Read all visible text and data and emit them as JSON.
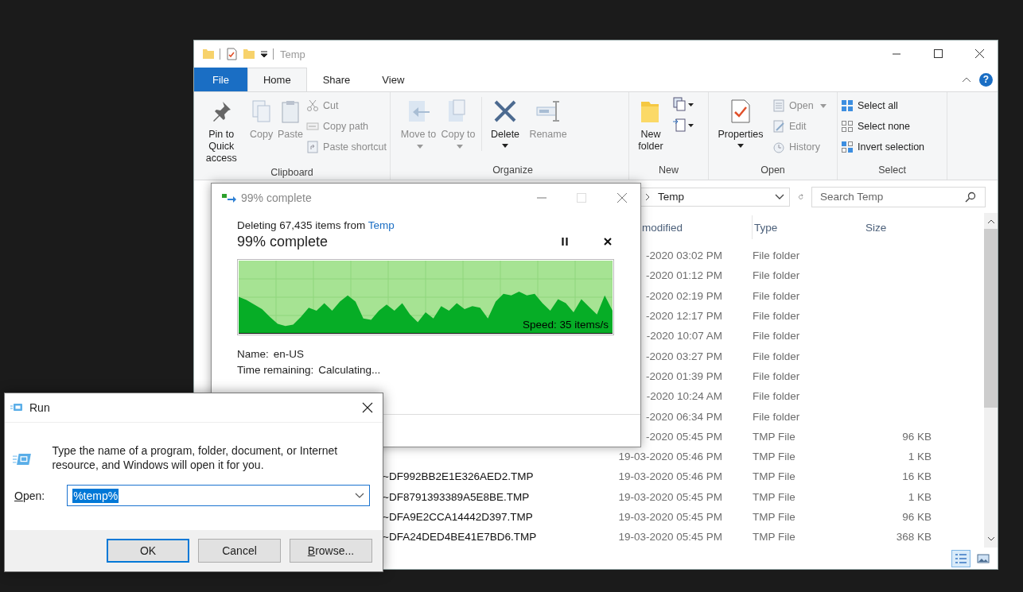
{
  "explorer": {
    "title": "Temp",
    "tabs": [
      {
        "label": "File",
        "kind": "backstage",
        "selected": false
      },
      {
        "label": "Home",
        "kind": "tab",
        "selected": true
      },
      {
        "label": "Share",
        "kind": "tab",
        "selected": false
      },
      {
        "label": "View",
        "kind": "tab",
        "selected": false
      }
    ],
    "help_label": "?",
    "ribbon": {
      "clipboard": {
        "label": "Clipboard",
        "pin": {
          "label": "Pin to Quick access",
          "disabled": false
        },
        "copy": {
          "label": "Copy",
          "disabled": true
        },
        "paste": {
          "label": "Paste",
          "disabled": true
        },
        "cut": {
          "label": "Cut",
          "disabled": true
        },
        "copy_path": {
          "label": "Copy path",
          "disabled": true
        },
        "paste_shortcut": {
          "label": "Paste shortcut",
          "disabled": true
        }
      },
      "organize": {
        "label": "Organize",
        "move_to": {
          "label": "Move to",
          "disabled": true
        },
        "copy_to": {
          "label": "Copy to",
          "disabled": true
        },
        "delete": {
          "label": "Delete",
          "disabled": false
        },
        "rename": {
          "label": "Rename",
          "disabled": true
        }
      },
      "new": {
        "label": "New",
        "new_folder": {
          "label": "New folder",
          "disabled": false
        }
      },
      "open": {
        "label": "Open",
        "properties": {
          "label": "Properties",
          "disabled": false
        },
        "open": {
          "label": "Open",
          "disabled": true
        },
        "edit": {
          "label": "Edit",
          "disabled": true
        },
        "history": {
          "label": "History",
          "disabled": true
        }
      },
      "select": {
        "label": "Select",
        "select_all": {
          "label": "Select all",
          "disabled": false
        },
        "select_none": {
          "label": "Select none",
          "disabled": false
        },
        "invert_selection": {
          "label": "Invert selection",
          "disabled": false
        }
      }
    },
    "address": {
      "location": "Temp"
    },
    "search": {
      "placeholder": "Search Temp"
    },
    "columns": {
      "date": "modified",
      "type": "Type",
      "size": "Size"
    },
    "rows": [
      {
        "date": "-2020 03:02 PM",
        "type": "File folder"
      },
      {
        "date": "-2020 01:12 PM",
        "type": "File folder"
      },
      {
        "date": "-2020 02:19 PM",
        "type": "File folder"
      },
      {
        "date": "-2020 12:17 PM",
        "type": "File folder"
      },
      {
        "date": "-2020 10:07 AM",
        "type": "File folder"
      },
      {
        "date": "-2020 03:27 PM",
        "type": "File folder"
      },
      {
        "date": "-2020 01:39 PM",
        "type": "File folder"
      },
      {
        "date": "-2020 10:24 AM",
        "type": "File folder"
      },
      {
        "date": "-2020 06:34 PM",
        "type": "File folder"
      },
      {
        "date": "-2020 05:45 PM",
        "type": "TMP File",
        "size": "96 KB"
      },
      {
        "date": "19-03-2020 05:46 PM",
        "type": "TMP File",
        "size": "1 KB"
      },
      {
        "name": "~DF992BB2E1E326AED2.TMP",
        "date": "19-03-2020 05:46 PM",
        "type": "TMP File",
        "size": "16 KB"
      },
      {
        "name": "~DF8791393389A5E8BE.TMP",
        "date": "19-03-2020 05:45 PM",
        "type": "TMP File",
        "size": "1 KB"
      },
      {
        "name": "~DFA9E2CCA14442D397.TMP",
        "date": "19-03-2020 05:45 PM",
        "type": "TMP File",
        "size": "96 KB"
      },
      {
        "name": "~DFA24DED4BE41E7BD6.TMP",
        "date": "19-03-2020 05:45 PM",
        "type": "TMP File",
        "size": "368 KB"
      }
    ],
    "view_buttons": [
      {
        "kind": "details",
        "selected": true
      },
      {
        "kind": "large_icons",
        "selected": false
      }
    ]
  },
  "progress_dialog": {
    "title": "99% complete",
    "can_maximize": false,
    "message": "Deleting 67,435 items from",
    "message_link": "Temp",
    "status": "99% complete",
    "speed": "Speed: 35 items/s",
    "details": [
      {
        "label": "Name:",
        "value": "en-US"
      },
      {
        "label": "Time remaining:",
        "value": "Calculating..."
      }
    ]
  },
  "run_dialog": {
    "title": "Run",
    "description": "Type the name of a program, folder, document, or Internet resource, and Windows will open it for you.",
    "open_label": "Open:",
    "open_label_mnemonic": true,
    "value": "%temp%",
    "value_selected": true,
    "buttons": [
      {
        "label": "OK",
        "default": true,
        "mnemonic": false
      },
      {
        "label": "Cancel",
        "default": false,
        "mnemonic": false
      },
      {
        "label": "Browse...",
        "default": false,
        "mnemonic": true
      }
    ]
  }
}
